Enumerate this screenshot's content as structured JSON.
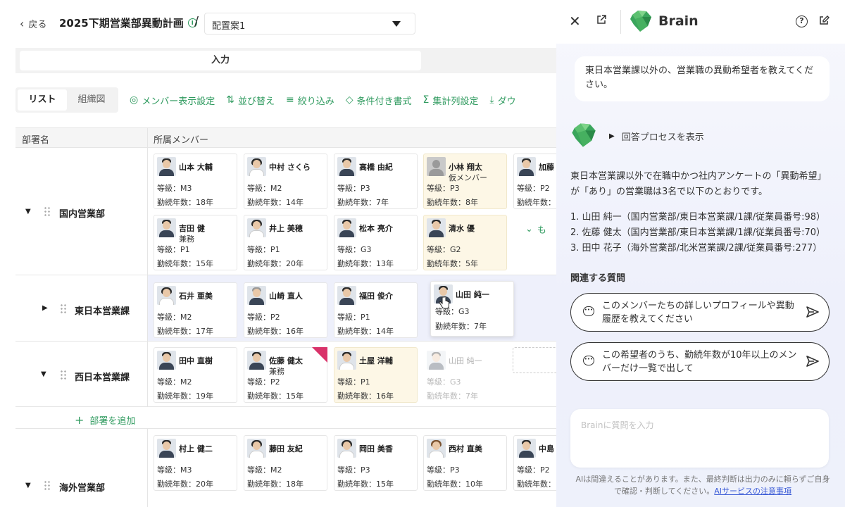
{
  "header": {
    "back_label": "戻る",
    "title": "2025下期営業部異動計画",
    "separator": "/",
    "plan_value": "配置案1"
  },
  "tabs": {
    "input": "入力"
  },
  "toolbar": {
    "view_list": "リスト",
    "view_org": "組織図",
    "member_display": "メンバー表示設定",
    "sort": "並び替え",
    "filter": "絞り込み",
    "conditional_format": "条件付き書式",
    "aggregate": "集計列設定",
    "download": "ダウ"
  },
  "grid": {
    "col_dept": "部署名",
    "col_members": "所属メンバー",
    "add_dept": "部署を追加",
    "more": "も"
  },
  "departments": [
    {
      "name": "国内営業部",
      "expanded": true
    },
    {
      "name": "東日本営業課",
      "expanded": false
    },
    {
      "name": "西日本営業課",
      "expanded": true
    },
    {
      "name": "海外営業部",
      "expanded": true
    }
  ],
  "cards": {
    "r1": [
      {
        "name": "山本 大輔",
        "grade": "等級：M3",
        "years": "勤続年数：18年"
      },
      {
        "name": "中村 さくら",
        "grade": "等級：M2",
        "years": "勤続年数：14年"
      },
      {
        "name": "高橋 由紀",
        "grade": "等級：P3",
        "years": "勤続年数：7年"
      },
      {
        "name": "小林 翔太",
        "sub": "仮メンバー",
        "grade": "等級：P3",
        "years": "勤続年数：8年"
      },
      {
        "name": "加藤",
        "grade": "等級：P2",
        "years": "勤続年数："
      }
    ],
    "r2": [
      {
        "name": "吉田 健",
        "sub": "兼務",
        "grade": "等級：P1",
        "years": "勤続年数：15年"
      },
      {
        "name": "井上 美穂",
        "grade": "等級：P1",
        "years": "勤続年数：20年"
      },
      {
        "name": "松本 亮介",
        "grade": "等級：G3",
        "years": "勤続年数：13年"
      },
      {
        "name": "清水 優",
        "grade": "等級：G2",
        "years": "勤続年数：5年"
      }
    ],
    "r3": [
      {
        "name": "石井 亜美",
        "grade": "等級：M2",
        "years": "勤続年数：17年"
      },
      {
        "name": "山崎 直人",
        "grade": "等級：P2",
        "years": "勤続年数：16年"
      },
      {
        "name": "福田 俊介",
        "grade": "等級：P1",
        "years": "勤続年数：14年"
      },
      {
        "name": "山田 純一",
        "grade": "等級：G3",
        "years": "勤続年数：7年"
      }
    ],
    "r4": [
      {
        "name": "田中 直樹",
        "grade": "等級：M2",
        "years": "勤続年数：19年"
      },
      {
        "name": "佐藤 健太",
        "sub": "兼務",
        "grade": "等級：P2",
        "years": "勤続年数：15年"
      },
      {
        "name": "土屋 洋輔",
        "grade": "等級：P1",
        "years": "勤続年数：16年"
      },
      {
        "name": "山田 純一",
        "grade": "等級：G3",
        "years": "勤続年数：7年"
      }
    ],
    "r5": [
      {
        "name": "村上 健二",
        "grade": "等級：M3",
        "years": "勤続年数：20年"
      },
      {
        "name": "藤田 友紀",
        "grade": "等級：M2",
        "years": "勤続年数：18年"
      },
      {
        "name": "岡田 美香",
        "grade": "等級：P3",
        "years": "勤続年数：15年"
      },
      {
        "name": "西村 直美",
        "grade": "等級：P3",
        "years": "勤続年数：10年"
      },
      {
        "name": "中島",
        "grade": "等級：P2",
        "years": "勤続年数："
      }
    ]
  },
  "assistant": {
    "brand": "Brain",
    "user_message": "東日本営業課以外の、営業職の異動希望者を教えてください。",
    "process_toggle": "回答プロセスを表示",
    "answer_intro": "東日本営業課以外で在職中かつ社内アンケートの「異動希望」が「あり」の営業職は3名で以下のとおりです。",
    "answer_items": [
      "1. 山田 純一（国内営業部/東日本営業課/1課/従業員番号:98）",
      "2. 佐藤 健太（国内営業部/東日本営業課/1課/従業員番号:70）",
      "3. 田中 花子（海外営業部/北米営業課/2課/従業員番号:277）"
    ],
    "related_title": "関連する質問",
    "suggestions": [
      "このメンバーたちの詳しいプロフィールや異動履歴を教えてください",
      "この希望者のうち、勤続年数が10年以上のメンバーだけ一覧で出して"
    ],
    "input_placeholder": "Brainに質問を入力",
    "disclaimer": "AIは間違えることがあります。また、最終判断は出力のみに頼らずご自身で確認・判断してください。",
    "disclaimer_link": "AIサービスの注意事項"
  },
  "colors": {
    "accent": "#2e9a5e",
    "temp_member": "#fdf7e6",
    "flag": "#d9336a",
    "link": "#3b5bd6"
  }
}
